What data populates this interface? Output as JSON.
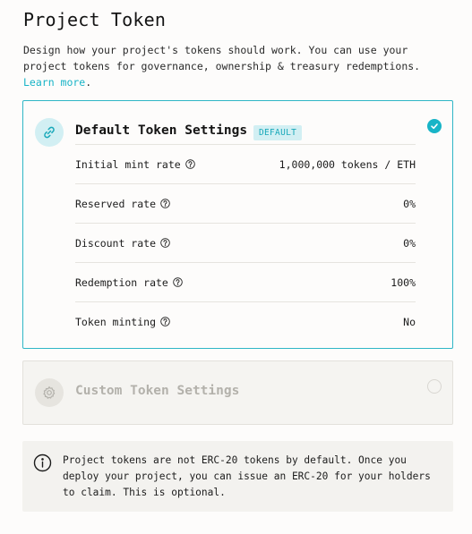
{
  "page": {
    "title": "Project Token",
    "description": "Design how your project's tokens should work. You can use your project tokens for governance, ownership & treasury redemptions.",
    "learn_more": "Learn more",
    "description_end": "."
  },
  "default_card": {
    "title": "Default Token Settings",
    "badge": "DEFAULT",
    "icon": "link-icon",
    "selected": true,
    "rows": [
      {
        "label": "Initial mint rate",
        "value": "1,000,000 tokens / ETH"
      },
      {
        "label": "Reserved rate",
        "value": "0%"
      },
      {
        "label": "Discount rate",
        "value": "0%"
      },
      {
        "label": "Redemption rate",
        "value": "100%"
      },
      {
        "label": "Token minting",
        "value": "No"
      }
    ]
  },
  "custom_card": {
    "title": "Custom Token Settings",
    "icon": "gear-icon",
    "selected": false
  },
  "info": {
    "icon": "info-icon",
    "text": "Project tokens are not ERC-20 tokens by default. Once you deploy your project, you can issue an ERC-20 for your holders to claim. This is optional."
  },
  "colors": {
    "accent": "#18b4c7",
    "accent_light": "#d2eff3",
    "border_selected": "#2fb6c6",
    "muted_text": "#b3b1ab"
  }
}
